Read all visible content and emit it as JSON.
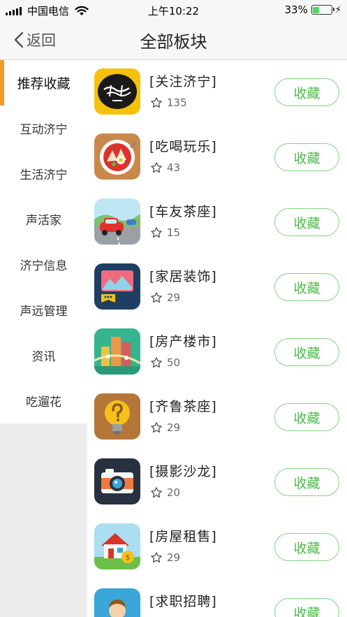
{
  "status_bar": {
    "carrier": "中国电信",
    "time": "上午10:22",
    "battery_percent": "33%",
    "battery_level": 0.33
  },
  "nav": {
    "back_label": "返回",
    "title": "全部板块"
  },
  "sidebar": {
    "items": [
      {
        "label": "推荐收藏",
        "active": true
      },
      {
        "label": "互动济宁"
      },
      {
        "label": "生活济宁"
      },
      {
        "label": "声活家"
      },
      {
        "label": "济宁信息"
      },
      {
        "label": "声远管理"
      },
      {
        "label": "资讯"
      },
      {
        "label": "吃遛花"
      }
    ]
  },
  "boards": [
    {
      "title": "[关注济宁]",
      "count": "135",
      "button": "收藏",
      "icon": "follow-jining-icon"
    },
    {
      "title": "[吃喝玩乐]",
      "count": "43",
      "button": "收藏",
      "icon": "food-plate-icon"
    },
    {
      "title": "[车友茶座]",
      "count": "15",
      "button": "收藏",
      "icon": "car-icon"
    },
    {
      "title": "[家居装饰]",
      "count": "29",
      "button": "收藏",
      "icon": "home-decor-icon"
    },
    {
      "title": "[房产楼市]",
      "count": "50",
      "button": "收藏",
      "icon": "real-estate-icon"
    },
    {
      "title": "[齐鲁茶座]",
      "count": "29",
      "button": "收藏",
      "icon": "lightbulb-question-icon"
    },
    {
      "title": "[摄影沙龙]",
      "count": "20",
      "button": "收藏",
      "icon": "camera-icon"
    },
    {
      "title": "[房屋租售]",
      "count": "29",
      "button": "收藏",
      "icon": "house-sale-icon"
    },
    {
      "title": "[求职招聘]",
      "count": "",
      "button": "收藏",
      "icon": "job-person-icon"
    }
  ],
  "colors": {
    "accent_active": "#f59a23",
    "button_border": "#7fd67f",
    "button_text": "#4cbb4c",
    "battery_fill": "#4cd964"
  }
}
